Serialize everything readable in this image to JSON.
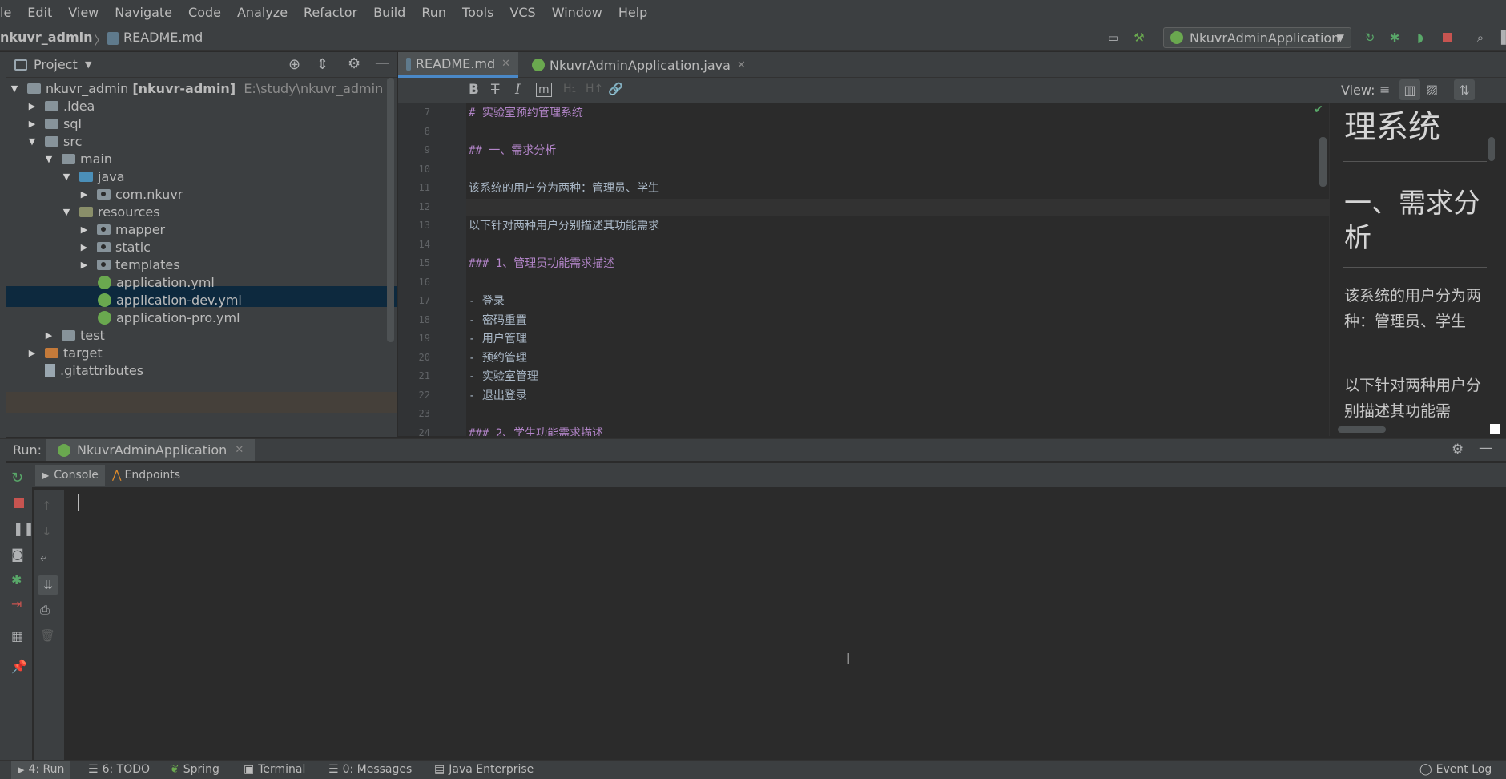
{
  "menu": [
    "le",
    "Edit",
    "View",
    "Navigate",
    "Code",
    "Analyze",
    "Refactor",
    "Build",
    "Run",
    "Tools",
    "VCS",
    "Window",
    "Help"
  ],
  "breadcrumb": {
    "project": "nkuvr_admin",
    "file": "README.md"
  },
  "run_config": "NkuvrAdminApplication",
  "project_panel": {
    "title": "Project",
    "tree": [
      {
        "label": "nkuvr_admin",
        "bold_suffix": "[nkuvr-admin]",
        "path": "E:\\study\\nkuvr_admin"
      },
      {
        "label": ".idea"
      },
      {
        "label": "sql"
      },
      {
        "label": "src"
      },
      {
        "label": "main"
      },
      {
        "label": "java"
      },
      {
        "label": "com.nkuvr"
      },
      {
        "label": "resources"
      },
      {
        "label": "mapper"
      },
      {
        "label": "static"
      },
      {
        "label": "templates"
      },
      {
        "label": "application.yml"
      },
      {
        "label": "application-dev.yml"
      },
      {
        "label": "application-pro.yml"
      },
      {
        "label": "test"
      },
      {
        "label": "target"
      },
      {
        "label": ".gitattributes"
      }
    ]
  },
  "editor_tabs": [
    {
      "label": "README.md",
      "active": true
    },
    {
      "label": "NkuvrAdminApplication.java",
      "active": false
    }
  ],
  "md_toolbar": {
    "view_label": "View:"
  },
  "editor": {
    "lines": [
      {
        "num": "7",
        "text": "# 实验室预约管理系统",
        "kind": "hdr"
      },
      {
        "num": "8",
        "text": "",
        "kind": "txt"
      },
      {
        "num": "9",
        "text": "## 一、需求分析",
        "kind": "hdr"
      },
      {
        "num": "10",
        "text": "",
        "kind": "txt"
      },
      {
        "num": "11",
        "text": "该系统的用户分为两种：管理员、学生",
        "kind": "txt"
      },
      {
        "num": "12",
        "text": "",
        "kind": "txt"
      },
      {
        "num": "13",
        "text": "以下针对两种用户分别描述其功能需求",
        "kind": "txt"
      },
      {
        "num": "14",
        "text": "",
        "kind": "txt"
      },
      {
        "num": "15",
        "text": "### 1、管理员功能需求描述",
        "kind": "hdr"
      },
      {
        "num": "16",
        "text": "",
        "kind": "txt"
      },
      {
        "num": "17",
        "text": "- 登录",
        "kind": "txt"
      },
      {
        "num": "18",
        "text": "- 密码重置",
        "kind": "txt"
      },
      {
        "num": "19",
        "text": "- 用户管理",
        "kind": "txt"
      },
      {
        "num": "20",
        "text": "- 预约管理",
        "kind": "txt"
      },
      {
        "num": "21",
        "text": "- 实验室管理",
        "kind": "txt"
      },
      {
        "num": "22",
        "text": "- 退出登录",
        "kind": "txt"
      },
      {
        "num": "23",
        "text": "",
        "kind": "txt"
      },
      {
        "num": "24",
        "text": "### 2、学生功能需求描述",
        "kind": "hdr"
      }
    ]
  },
  "preview": {
    "h1_tail": "理系统",
    "h2": "一、需求分析",
    "p1": "该系统的用户分为两种：管理员、学生",
    "p2": "以下针对两种用户分别描述其功能需"
  },
  "run_panel": {
    "label": "Run:",
    "tab": "NkuvrAdminApplication",
    "subtabs": [
      "Console",
      "Endpoints"
    ]
  },
  "statusbar": {
    "items": [
      "4: Run",
      "6: TODO",
      "Spring",
      "Terminal",
      "0: Messages",
      "Java Enterprise"
    ],
    "right": "Event Log"
  },
  "colors": {
    "accent": "#4a88c7",
    "selection": "#0d293e",
    "header_md": "#b385c9"
  }
}
